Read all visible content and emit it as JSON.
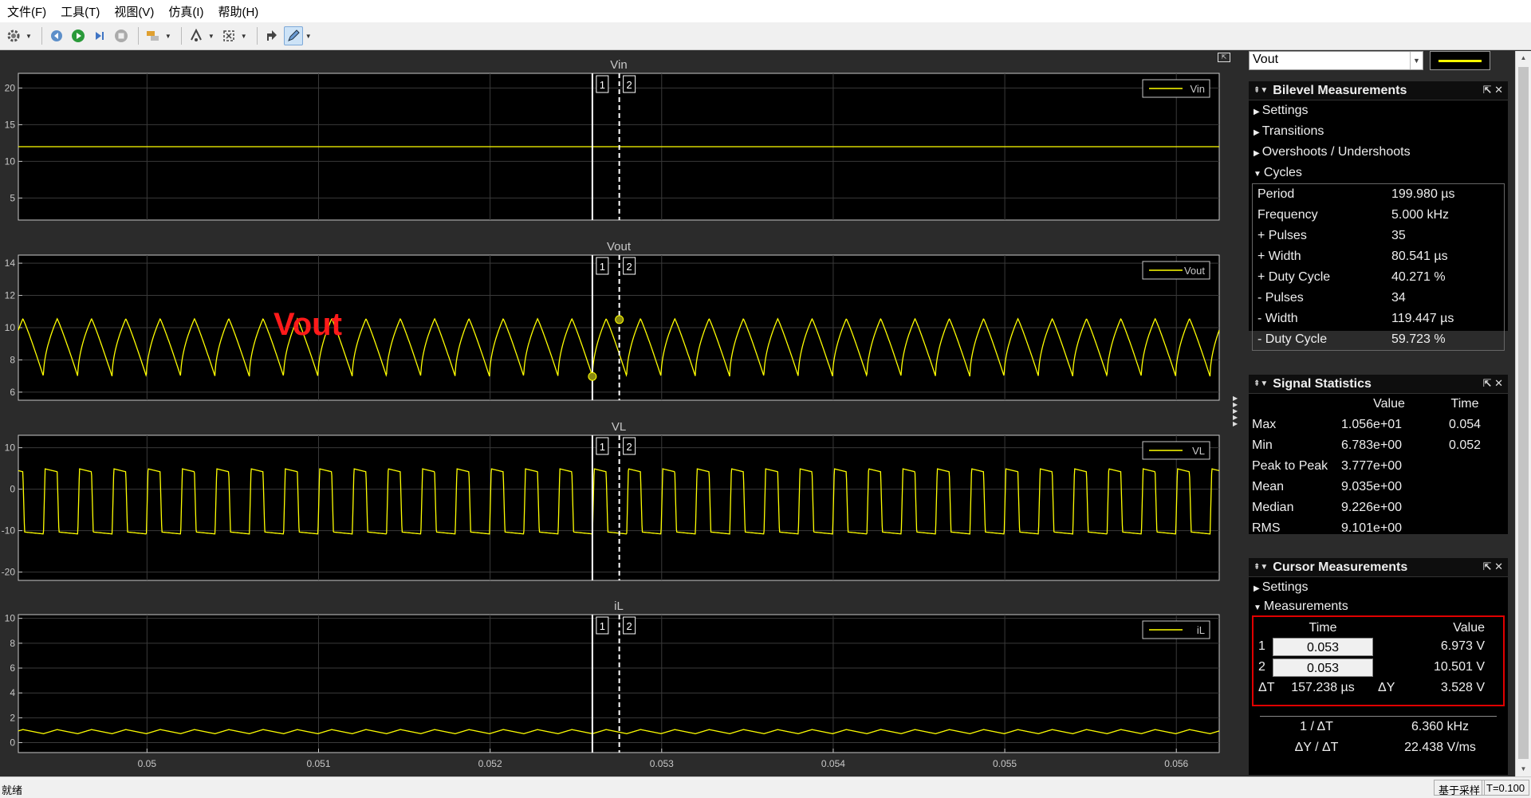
{
  "menu": [
    "文件(F)",
    "工具(T)",
    "视图(V)",
    "仿真(I)",
    "帮助(H)"
  ],
  "toolbar": {
    "icons": [
      "gear-icon",
      "step-back-icon",
      "run-icon",
      "step-forward-icon",
      "stop-icon",
      "highlight-block-icon",
      "triggers-icon",
      "zoom-fit-icon",
      "undock-plot-icon",
      "edit-cursor-icon"
    ]
  },
  "plots": [
    {
      "title": "Vin",
      "legend": "Vin",
      "ylim": [
        2,
        22
      ],
      "yticks": [
        5,
        10,
        15,
        20
      ]
    },
    {
      "title": "Vout",
      "legend": "Vout",
      "ylim": [
        5.5,
        14.5
      ],
      "yticks": [
        6,
        8,
        10,
        12,
        14
      ]
    },
    {
      "title": "VL",
      "legend": "VL",
      "ylim": [
        -22,
        13
      ],
      "yticks": [
        -20,
        -10,
        0,
        10
      ]
    },
    {
      "title": "iL",
      "legend": "iL",
      "ylim": [
        -0.8,
        10.3
      ],
      "yticks": [
        0,
        2,
        4,
        6,
        8,
        10
      ]
    }
  ],
  "x_axis": {
    "xlim": [
      0.04925,
      0.05625
    ],
    "xticks": [
      "0.05",
      "0.051",
      "0.052",
      "0.053",
      "0.054",
      "0.055",
      "0.056"
    ]
  },
  "cursors": {
    "c1_label": "1",
    "c2_label": "2",
    "c1_time": 0.052596,
    "c2_time": 0.052753
  },
  "annotation": "Vout",
  "right_panel": {
    "signal": "Vout",
    "bilevel": {
      "title": "Bilevel Measurements",
      "sections": [
        "Settings",
        "Transitions",
        "Overshoots / Undershoots",
        "Cycles"
      ],
      "cycles": [
        {
          "k": "Period",
          "v": "199.980 µs"
        },
        {
          "k": "Frequency",
          "v": "5.000 kHz"
        },
        {
          "k": "+ Pulses",
          "v": "35"
        },
        {
          "k": "+ Width",
          "v": "80.541 µs"
        },
        {
          "k": "+ Duty Cycle",
          "v": "40.271 %"
        },
        {
          "k": "- Pulses",
          "v": "34"
        },
        {
          "k": "- Width",
          "v": "119.447 µs"
        },
        {
          "k": "- Duty Cycle",
          "v": "59.723 %"
        }
      ]
    },
    "stats": {
      "title": "Signal Statistics",
      "col_value": "Value",
      "col_time": "Time",
      "rows": [
        {
          "k": "Max",
          "v": "1.056e+01",
          "t": "0.054"
        },
        {
          "k": "Min",
          "v": "6.783e+00",
          "t": "0.052"
        },
        {
          "k": "Peak to Peak",
          "v": "3.777e+00",
          "t": ""
        },
        {
          "k": "Mean",
          "v": "9.035e+00",
          "t": ""
        },
        {
          "k": "Median",
          "v": "9.226e+00",
          "t": ""
        },
        {
          "k": "RMS",
          "v": "9.101e+00",
          "t": ""
        }
      ]
    },
    "cursor_meas": {
      "title": "Cursor Measurements",
      "sections": [
        "Settings",
        "Measurements"
      ],
      "col_time": "Time",
      "col_value": "Value",
      "c1_label": "1",
      "c2_label": "2",
      "c1_time": "0.053",
      "c1_value": "6.973 V",
      "c2_time": "0.053",
      "c2_value": "10.501 V",
      "dt_label": "ΔT",
      "dt": "157.238 µs",
      "dy_label": "ΔY",
      "dy": "3.528 V",
      "inv_dt_label": "1 / ΔT",
      "inv_dt": "6.360 kHz",
      "slope_label": "ΔY / ΔT",
      "slope": "22.438 V/ms"
    }
  },
  "status": {
    "text": "就绪",
    "mode": "基于采样",
    "time": "T=0.100"
  }
}
